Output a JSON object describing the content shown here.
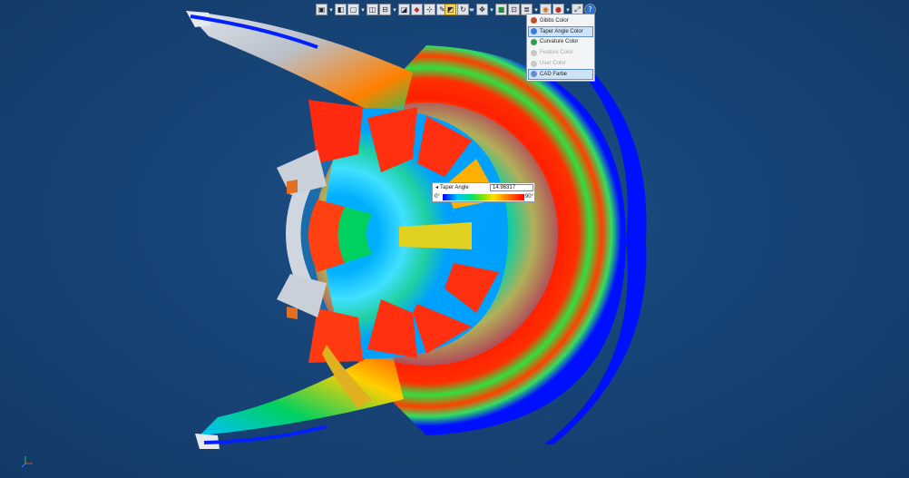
{
  "toolbar_left": {
    "buttons": [
      {
        "icon": "view-cube-icon"
      },
      {
        "icon": "shaded-view-icon"
      },
      {
        "icon": "wireframe-icon"
      },
      {
        "icon": "hidden-line-icon"
      },
      {
        "icon": "section-icon"
      },
      {
        "icon": "select-icon"
      },
      {
        "icon": "color-body-icon"
      },
      {
        "icon": "measure-icon"
      },
      {
        "icon": "annotation-icon"
      },
      {
        "icon": "clipping-box-icon"
      }
    ]
  },
  "toolbar_mid": {
    "buttons": [
      {
        "icon": "highlight-icon",
        "active": true
      },
      {
        "icon": "rotate-icon"
      },
      {
        "icon": "move-icon"
      },
      {
        "icon": "part-color-icon"
      },
      {
        "icon": "dimension-icon"
      },
      {
        "icon": "layer-icon"
      },
      {
        "icon": "analysis-icon"
      },
      {
        "icon": "sphere-color-icon"
      },
      {
        "icon": "display-mode-icon"
      }
    ]
  },
  "toolbar_right": {
    "buttons": [
      {
        "icon": "fit-view-icon"
      },
      {
        "icon": "help-icon"
      }
    ]
  },
  "color_menu": {
    "items": [
      {
        "label": "Gibbs Color",
        "icon_color": "#c0502a",
        "state": "normal"
      },
      {
        "label": "Taper Angle Color",
        "icon_color": "#3a7ed8",
        "state": "highlighted"
      },
      {
        "label": "Curvature Color",
        "icon_color": "#2aa050",
        "state": "normal"
      },
      {
        "label": "Feature Color",
        "icon_color": "#c8c8c8",
        "state": "disabled"
      },
      {
        "label": "User Color",
        "icon_color": "#c8c8c8",
        "state": "disabled"
      },
      {
        "label": "CAD Farbe",
        "icon_color": "#6a8bd0",
        "state": "highlighted"
      }
    ]
  },
  "taper_tooltip": {
    "label": "Taper Angle",
    "value": "14.96317",
    "min_label": "0°",
    "max_label": "90°"
  },
  "colors": {
    "background": "#174477",
    "gradient": [
      "#0000ff",
      "#00c8ff",
      "#00e070",
      "#ffe000",
      "#ff0000"
    ]
  }
}
